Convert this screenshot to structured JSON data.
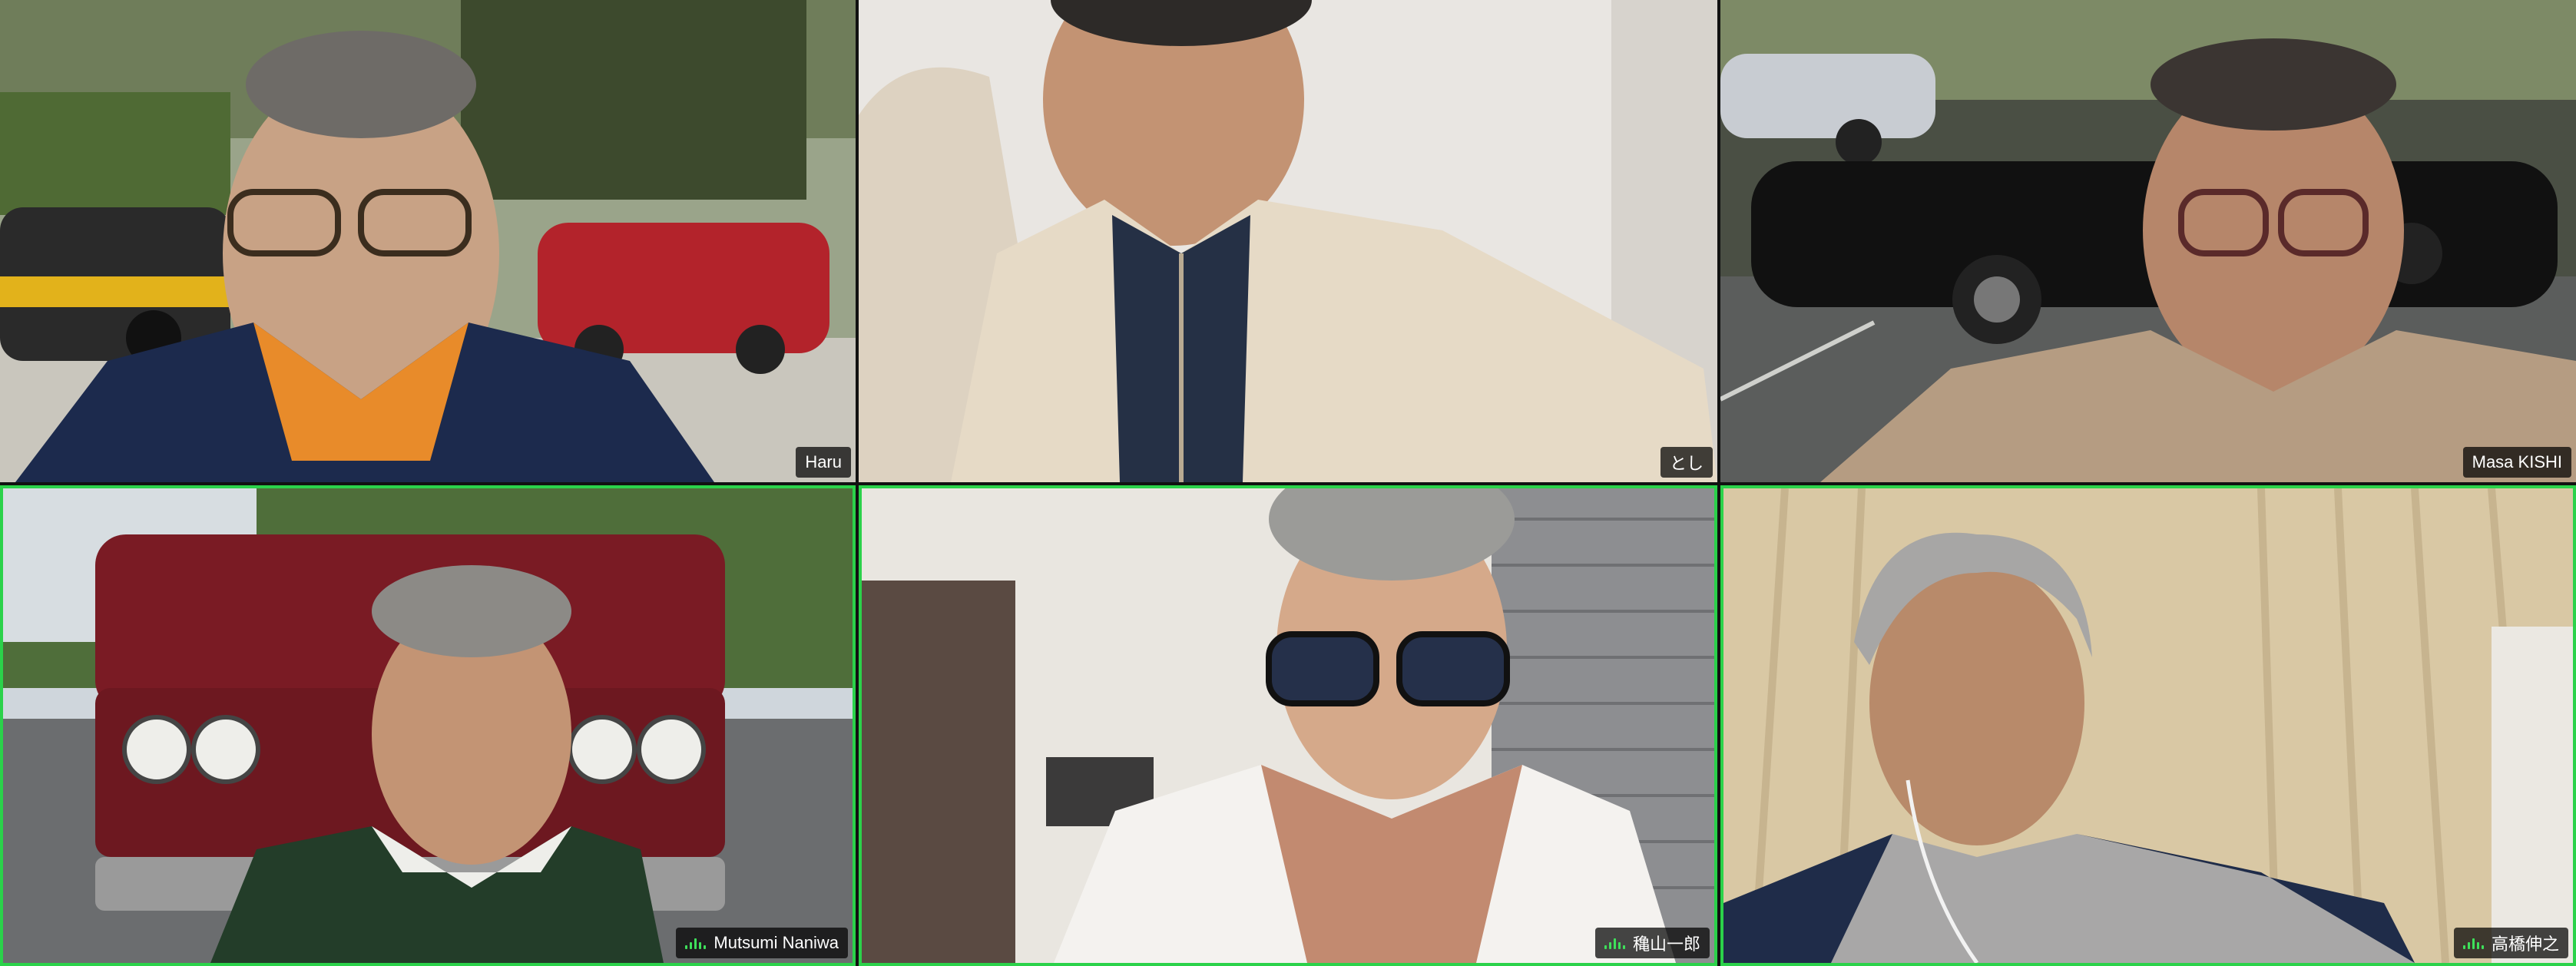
{
  "meeting": {
    "participants": [
      {
        "name": "Haru",
        "speaking": false,
        "audio_active": false
      },
      {
        "name": "とし",
        "speaking": false,
        "audio_active": false
      },
      {
        "name": "Masa KISHI",
        "speaking": false,
        "audio_active": false
      },
      {
        "name": "Mutsumi Naniwa",
        "speaking": true,
        "audio_active": true
      },
      {
        "name": "穐山一郎",
        "speaking": true,
        "audio_active": true
      },
      {
        "name": "高橋伸之",
        "speaking": true,
        "audio_active": true
      }
    ]
  },
  "colors": {
    "active_speaker_border": "#2bd24a",
    "audio_indicator": "#3ee05a",
    "name_tag_background": "rgba(0,0,0,0.72)"
  }
}
